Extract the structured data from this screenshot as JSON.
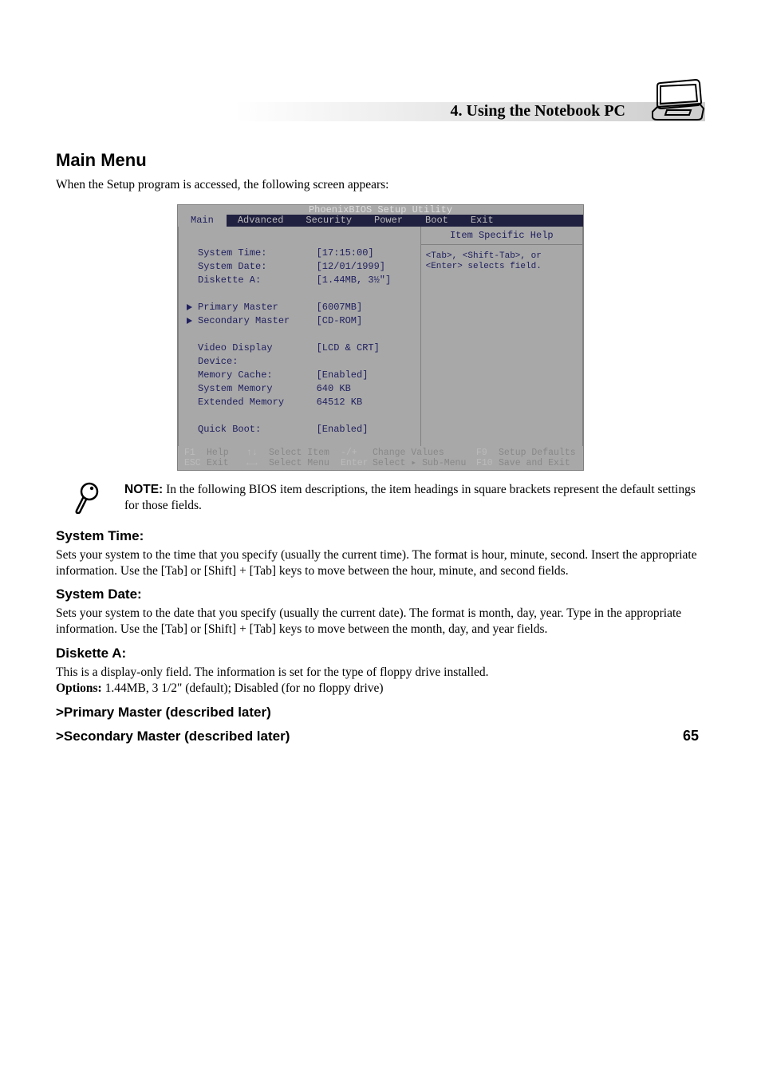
{
  "header": {
    "chapter": "4. Using the Notebook PC"
  },
  "main_menu": {
    "title": "Main Menu",
    "intro": "When the Setup program is accessed, the following screen appears:",
    "bios": {
      "utility_title": "PhoenixBIOS Setup Utility",
      "tabs": [
        "Main",
        "Advanced",
        "Security",
        "Power",
        "Boot",
        "Exit"
      ],
      "active_tab": "Main",
      "rows": [
        {
          "label": "System Time:",
          "value": "[17:15:00]"
        },
        {
          "label": "System Date:",
          "value": "[12/01/1999]"
        },
        {
          "label": "Diskette A:",
          "value": "[1.44MB, 3½\"]"
        }
      ],
      "subs": [
        {
          "label": "Primary Master",
          "value": "[6007MB]"
        },
        {
          "label": "Secondary Master",
          "value": "[CD-ROM]"
        }
      ],
      "rows2": [
        {
          "label": "Video Display Device:",
          "value": "[LCD & CRT]"
        },
        {
          "label": "Memory Cache:",
          "value": "[Enabled]"
        },
        {
          "label": "System Memory",
          "value": "640 KB"
        },
        {
          "label": "Extended Memory",
          "value": "64512 KB"
        },
        {
          "label": "Quick Boot:",
          "value": "[Enabled]"
        }
      ],
      "help_title": "Item Specific Help",
      "help_body": "<Tab>, <Shift-Tab>, or <Enter> selects field.",
      "footer": [
        {
          "k": "F1",
          "v": "Help"
        },
        {
          "k": "↑↓",
          "v": "Select Item"
        },
        {
          "k": "-/+",
          "v": "Change Values"
        },
        {
          "k": "F9",
          "v": "Setup Defaults"
        },
        {
          "k": "ESC",
          "v": "Exit"
        },
        {
          "k": "←→",
          "v": "Select Menu"
        },
        {
          "k": "Enter",
          "v": "Select ▸ Sub-Menu"
        },
        {
          "k": "F10",
          "v": "Save and Exit"
        }
      ]
    },
    "note_label": "NOTE:",
    "note_text": " In the following BIOS item descriptions, the item headings in square brackets represent the default settings for those fields.",
    "items": [
      {
        "title": "System Time:",
        "text": "Sets your system to the time that you specify (usually the current time). The format is hour, minute, second. Insert the appropriate information. Use the [Tab] or [Shift] + [Tab] keys to move between the hour, minute, and second fields."
      },
      {
        "title": "System Date:",
        "text": "Sets your system to the date that you specify (usually the current date). The format is month, day, year. Type in the appropriate information. Use the [Tab] or [Shift] + [Tab] keys to move between the month, day, and year fields."
      },
      {
        "title": "Diskette A:",
        "text": "This is a display-only field. The information is set for the type of floppy drive installed.",
        "opts_label": "Options:",
        "opts": " 1.44MB, 3 1/2\" (default); Disabled (for no floppy drive)"
      },
      {
        "title": ">Primary Master  (described later)"
      },
      {
        "title": ">Secondary Master  (described later)"
      }
    ]
  },
  "page_number": "65"
}
